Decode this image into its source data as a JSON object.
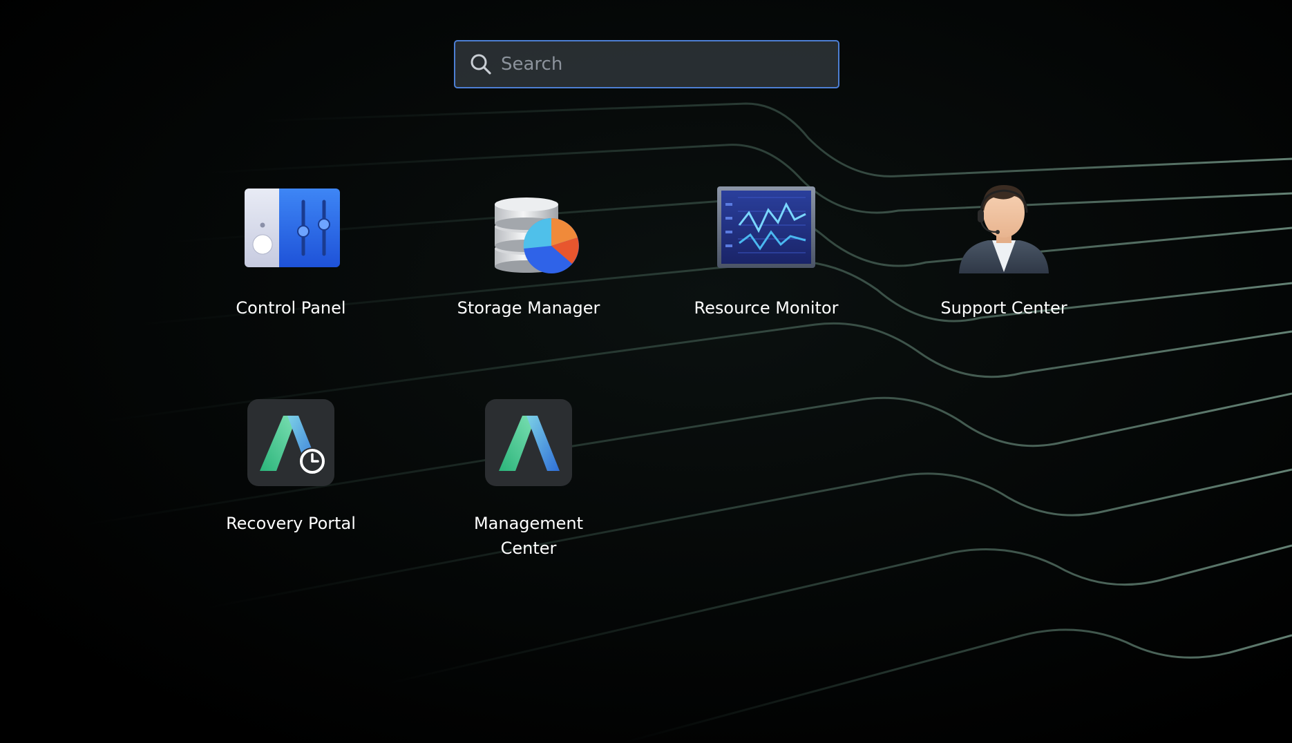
{
  "search": {
    "placeholder": "Search",
    "value": ""
  },
  "apps": [
    {
      "label": "Control Panel",
      "icon": "control-panel-icon"
    },
    {
      "label": "Storage Manager",
      "icon": "storage-manager-icon"
    },
    {
      "label": "Resource Monitor",
      "icon": "resource-monitor-icon"
    },
    {
      "label": "Support Center",
      "icon": "support-center-icon"
    },
    {
      "label": "Recovery Portal",
      "icon": "recovery-portal-icon"
    },
    {
      "label": "Management Center",
      "icon": "management-center-icon"
    }
  ],
  "colors": {
    "background": "#000000",
    "search_border": "#4d7fd4",
    "accent_blue": "#2f6df0",
    "accent_green": "#3dbf8a"
  }
}
